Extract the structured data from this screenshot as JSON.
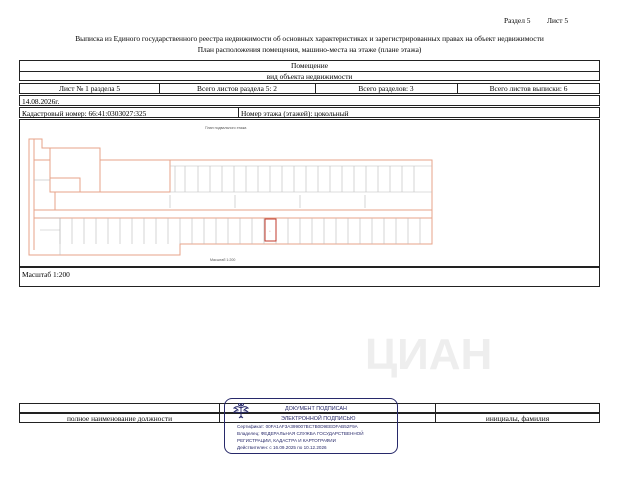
{
  "header": {
    "section": "Раздел 5",
    "sheet": "Лист 5",
    "title_line1": "Выписка из Единого государственного реестра недвижимости об основных характеристиках и зарегистрированных правах на объект недвижимости",
    "title_line2": "План расположения помещения, машино-места на этаже (плане этажа)"
  },
  "object": {
    "name": "Помещение",
    "caption": "вид объекта недвижимости"
  },
  "sheets_row": {
    "sheet_no": "Лист № 1 раздела 5",
    "total_in_section": "Всего листов раздела 5: 2",
    "total_sections": "Всего разделов: 3",
    "total_sheets": "Всего листов выписки: 6"
  },
  "date": "14.08.2026г.",
  "cadastral_number": "Кадастровый номер: 66:41:0303027:325",
  "floor": "Номер этажа (этажей): цокольный",
  "scale": "Масштаб 1:200",
  "plan": {
    "top_caption": "План подвального этажа",
    "bottom_caption": "Масштаб 1:200",
    "colors": {
      "walls": "#e7a38a",
      "lines": "#bbbbbb",
      "highlight": "#c0392b"
    }
  },
  "signature_row": {
    "position_label": "полное наименование должности",
    "name_label": "инициалы, фамилия"
  },
  "stamp": {
    "title": "ДОКУМЕНТ ПОДПИСАН",
    "subtitle": "ЭЛЕКТРОННОЙ ПОДПИСЬЮ",
    "certificate": "Сертификат: 00FA1AF3A399007BC7B0D9EEDFAB52F9A",
    "owner_line1": "Владелец: ФЕДЕРАЛЬНАЯ СЛУЖБА ГОСУДАРСТВЕННОЙ",
    "owner_line2": "РЕГИСТРАЦИИ, КАДАСТРА И КАРТОГРАФИИ",
    "validity": "Действителен: с 16.09.2025 по 10.12.2026",
    "emblem_icon": "eagle-emblem-icon",
    "color": "#27296a"
  }
}
